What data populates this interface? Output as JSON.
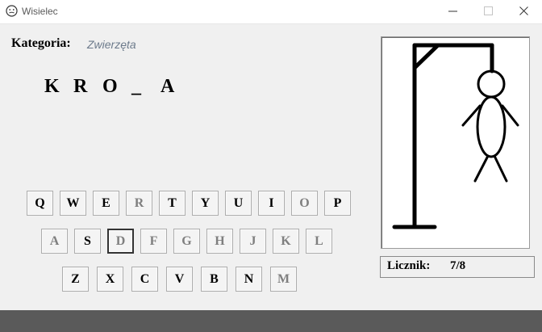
{
  "window": {
    "title": "Wisielec"
  },
  "category": {
    "label": "Kategoria:",
    "value": "Zwierzęta"
  },
  "word": [
    "K",
    "R",
    "O",
    "_",
    "A"
  ],
  "keyboard": {
    "row1": [
      "Q",
      "W",
      "E",
      "R",
      "T",
      "Y",
      "U",
      "I",
      "O",
      "P"
    ],
    "row2": [
      "A",
      "S",
      "D",
      "F",
      "G",
      "H",
      "J",
      "K",
      "L"
    ],
    "row3": [
      "Z",
      "X",
      "C",
      "V",
      "B",
      "N",
      "M"
    ]
  },
  "counter": {
    "label": "Licznik:",
    "value": "7/8"
  }
}
